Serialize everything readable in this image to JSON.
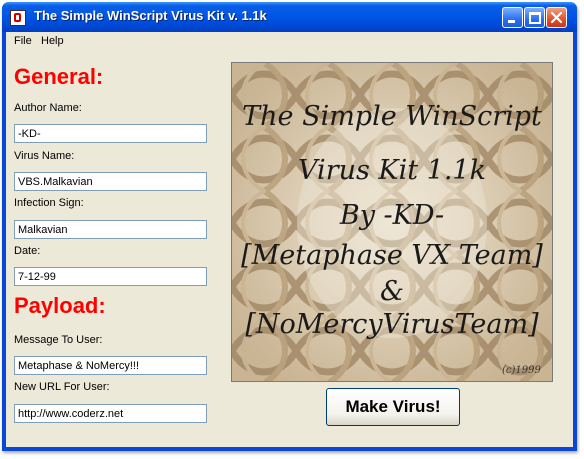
{
  "window": {
    "title": "The Simple WinScript Virus Kit v. 1.1k"
  },
  "menu": {
    "file": "File",
    "help": "Help"
  },
  "general": {
    "heading": "General:",
    "author_label": "Author Name:",
    "author_value": "-KD-",
    "virus_label": "Virus Name:",
    "virus_value": "VBS.Malkavian",
    "infection_label": "Infection Sign:",
    "infection_value": "Malkavian",
    "date_label": "Date:",
    "date_value": "7-12-99"
  },
  "payload": {
    "heading": "Payload:",
    "message_label": "Message To User:",
    "message_value": "Metaphase & NoMercy!!!",
    "url_label": "New URL For User:",
    "url_value": "http://www.coderz.net"
  },
  "picture": {
    "line1": "The Simple WinScript",
    "line2": "Virus Kit 1.1k",
    "line3": "By -KD-",
    "line4": "[Metaphase VX Team]",
    "line5": "&",
    "line6": "[NoMercyVirusTeam]",
    "credit": "(c)1999"
  },
  "buttons": {
    "make_virus": "Make Virus!"
  },
  "colors": {
    "section_heading": "#ff0000",
    "titlebar": "#0055e5",
    "client_bg": "#ece9d8"
  },
  "icons": [
    "app-icon",
    "minimize-icon",
    "maximize-icon",
    "close-icon"
  ]
}
